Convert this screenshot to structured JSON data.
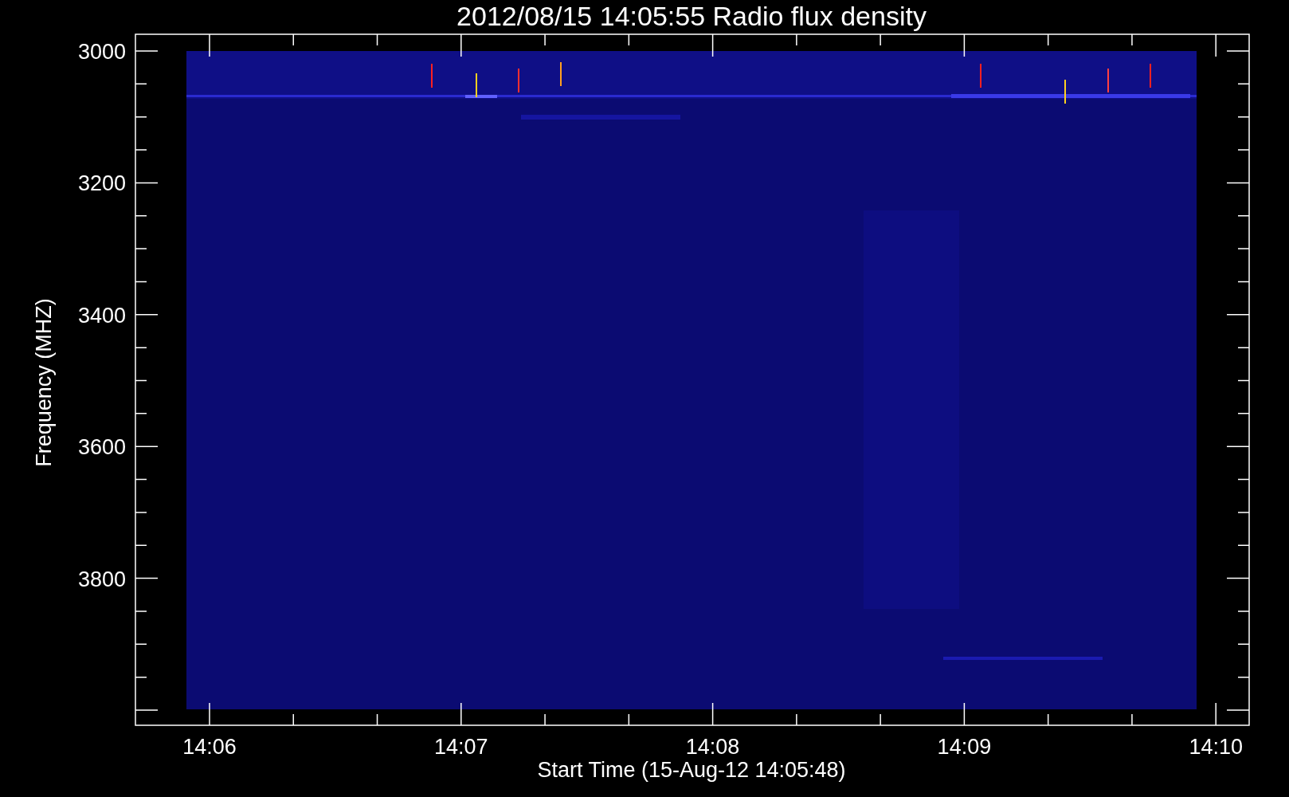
{
  "title": "2012/08/15 14:05:55 Radio flux density",
  "y_axis": {
    "label": "Frequency (MHZ)",
    "ticks": [
      "3000",
      "3200",
      "3400",
      "3600",
      "3800"
    ]
  },
  "x_axis": {
    "label": "Start Time (15-Aug-12 14:05:48)",
    "ticks": [
      "14:06",
      "14:07",
      "14:08",
      "14:09",
      "14:10"
    ]
  }
}
